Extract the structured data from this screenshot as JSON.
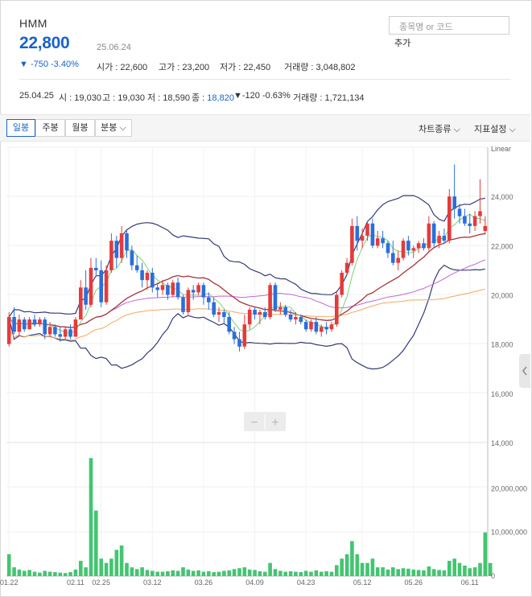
{
  "header": {
    "name": "HMM",
    "price": "22,800",
    "date": "25.06.24",
    "change": "▼ -750  -3.40%",
    "open_label": "시가 : ",
    "open": "22,600",
    "high_label": "고가 : ",
    "high": "23,200",
    "low_label": "저가 : ",
    "low": "22,450",
    "volume_label": "거래량 : ",
    "volume": "3,048,802"
  },
  "search": {
    "placeholder": "종목명 or 코드",
    "add_label": "추가"
  },
  "prev_day": {
    "date": "25.04.25",
    "open": "시 : 19,030",
    "high": "고 : 19,030",
    "low": "저 : 18,590",
    "close_label": "종 : ",
    "close": "18,820",
    "change": "▼-120  -0.63%",
    "volume": "거래량 : 1,721,134"
  },
  "toolbar": {
    "tabs": [
      "일봉",
      "주봉",
      "월봉",
      "분봉"
    ],
    "active_tab": "일봉",
    "chart_type_label": "차트종류",
    "indicator_label": "지표설정"
  },
  "zoom": {
    "minus": "−",
    "plus": "+"
  },
  "colors": {
    "up": "#e43b3b",
    "down": "#2a6fdb",
    "volume": "#43c571",
    "bollinger": "#353a7a",
    "ma_short": "#7ad27a",
    "ma_mid": "#a83236",
    "ma_long": "#c267d6",
    "ma_longest": "#f2a863"
  },
  "chart_data": {
    "type": "candlestick",
    "scale_label": "Linear",
    "ylim": [
      14000,
      26000
    ],
    "y_ticks": [
      "14,000",
      "16,000",
      "18,000",
      "20,000",
      "22,000",
      "24,000"
    ],
    "volume_ylim": [
      0,
      30000000
    ],
    "volume_ticks": [
      "0",
      "10,000,000",
      "20,000,000"
    ],
    "x_ticks": [
      "01.22",
      "02.11",
      "02.25",
      "03.12",
      "03.26",
      "04.09",
      "04.23",
      "05.12",
      "05.26",
      "06.11"
    ],
    "candles": [
      [
        18000,
        19300,
        17900,
        19100
      ],
      [
        19100,
        19500,
        18400,
        18500
      ],
      [
        18500,
        19200,
        18300,
        19000
      ],
      [
        19000,
        19100,
        18500,
        18600
      ],
      [
        18600,
        19100,
        18600,
        19000
      ],
      [
        19000,
        19200,
        18700,
        18800
      ],
      [
        18800,
        19100,
        18700,
        19000
      ],
      [
        19000,
        19100,
        18200,
        18400
      ],
      [
        18400,
        18900,
        18300,
        18700
      ],
      [
        18700,
        18800,
        18300,
        18400
      ],
      [
        18400,
        18700,
        18100,
        18300
      ],
      [
        18300,
        18700,
        18200,
        18600
      ],
      [
        18600,
        18800,
        18200,
        18300
      ],
      [
        18300,
        19100,
        18300,
        19000
      ],
      [
        19000,
        20600,
        19000,
        20300
      ],
      [
        20300,
        21000,
        19400,
        19600
      ],
      [
        19600,
        21500,
        19500,
        21100
      ],
      [
        21100,
        21500,
        20800,
        21000
      ],
      [
        21000,
        21400,
        19500,
        19700
      ],
      [
        19700,
        21200,
        19600,
        21000
      ],
      [
        21000,
        22500,
        20900,
        22200
      ],
      [
        22200,
        22400,
        21100,
        21500
      ],
      [
        21500,
        22800,
        21300,
        22500
      ],
      [
        22500,
        22600,
        21500,
        21800
      ],
      [
        21800,
        22000,
        21000,
        21200
      ],
      [
        21200,
        21600,
        20900,
        21000
      ],
      [
        21000,
        21300,
        20300,
        20600
      ],
      [
        20600,
        21000,
        20200,
        20900
      ],
      [
        20900,
        21100,
        20100,
        20300
      ],
      [
        20300,
        20500,
        19900,
        20200
      ],
      [
        20200,
        20600,
        20000,
        20400
      ],
      [
        20400,
        20500,
        19800,
        20000
      ],
      [
        20000,
        20600,
        19900,
        20500
      ],
      [
        20500,
        20700,
        19800,
        19900
      ],
      [
        19900,
        20000,
        19200,
        19300
      ],
      [
        19300,
        20300,
        19200,
        20200
      ],
      [
        20200,
        20400,
        19800,
        20100
      ],
      [
        20100,
        20500,
        20000,
        20400
      ],
      [
        20400,
        20500,
        19600,
        19900
      ],
      [
        19900,
        20100,
        19400,
        19700
      ],
      [
        19700,
        19900,
        19100,
        19200
      ],
      [
        19200,
        19500,
        18900,
        19300
      ],
      [
        19300,
        19400,
        18800,
        19100
      ],
      [
        19100,
        19300,
        18400,
        18500
      ],
      [
        18500,
        18700,
        18000,
        18200
      ],
      [
        18200,
        18500,
        17700,
        17900
      ],
      [
        17900,
        19200,
        17800,
        18800
      ],
      [
        18800,
        19500,
        18600,
        19400
      ],
      [
        19400,
        19500,
        19000,
        19200
      ],
      [
        19200,
        19400,
        18800,
        19300
      ],
      [
        19300,
        19500,
        19000,
        19100
      ],
      [
        19100,
        20500,
        19000,
        20400
      ],
      [
        20400,
        20500,
        19300,
        19400
      ],
      [
        19400,
        19700,
        19200,
        19500
      ],
      [
        19500,
        19600,
        19100,
        19200
      ],
      [
        19200,
        19400,
        18900,
        19000
      ],
      [
        19000,
        19300,
        18800,
        19100
      ],
      [
        19100,
        19200,
        18800,
        18900
      ],
      [
        18900,
        19000,
        18500,
        18600
      ],
      [
        18600,
        19000,
        18500,
        18900
      ],
      [
        18900,
        19100,
        18400,
        18500
      ],
      [
        18500,
        18800,
        18300,
        18700
      ],
      [
        18700,
        18900,
        18400,
        18600
      ],
      [
        18600,
        18900,
        18500,
        18800
      ],
      [
        18800,
        20100,
        18700,
        20000
      ],
      [
        20000,
        21000,
        19900,
        20900
      ],
      [
        20900,
        21500,
        20800,
        21300
      ],
      [
        21300,
        23100,
        21200,
        22800
      ],
      [
        22800,
        23200,
        21800,
        22200
      ],
      [
        22200,
        22700,
        21900,
        22400
      ],
      [
        22400,
        23000,
        22200,
        22900
      ],
      [
        22900,
        23100,
        21900,
        22000
      ],
      [
        22000,
        22600,
        21900,
        22300
      ],
      [
        22300,
        22600,
        21900,
        22100
      ],
      [
        22100,
        22200,
        21500,
        21700
      ],
      [
        21700,
        22200,
        21200,
        21300
      ],
      [
        21300,
        21800,
        21000,
        21500
      ],
      [
        21500,
        22300,
        21400,
        22200
      ],
      [
        22200,
        22400,
        21600,
        21800
      ],
      [
        21800,
        22000,
        21500,
        21900
      ],
      [
        21900,
        22200,
        21700,
        22100
      ],
      [
        22100,
        22300,
        21800,
        21900
      ],
      [
        21900,
        23200,
        21800,
        22900
      ],
      [
        22900,
        23000,
        21900,
        22100
      ],
      [
        22100,
        22600,
        21900,
        22400
      ],
      [
        22400,
        22700,
        22100,
        22200
      ],
      [
        22200,
        24300,
        22100,
        24000
      ],
      [
        24000,
        25300,
        23100,
        23500
      ],
      [
        23500,
        23700,
        22900,
        23200
      ],
      [
        23200,
        23500,
        22800,
        22900
      ],
      [
        22900,
        23300,
        22500,
        22800
      ],
      [
        22800,
        23400,
        22600,
        23200
      ],
      [
        23200,
        24700,
        22900,
        23400
      ],
      [
        22600,
        23200,
        22450,
        22800
      ]
    ],
    "volume_millions": [
      5,
      2,
      1.5,
      1.2,
      1.4,
      1.0,
      0.8,
      1.2,
      1.0,
      0.9,
      0.8,
      0.7,
      0.9,
      1.5,
      3.5,
      2.0,
      27,
      15,
      4,
      3,
      4,
      6,
      7,
      3,
      2,
      1.6,
      2.0,
      1.4,
      1.2,
      1.0,
      1.0,
      1.1,
      1.3,
      1.2,
      2.0,
      1.5,
      1.2,
      1.3,
      1.0,
      1.1,
      0.9,
      1.0,
      1.2,
      1.3,
      1.6,
      1.8,
      2.0,
      1.5,
      1.4,
      1.1,
      1.0,
      3.0,
      1.6,
      1.2,
      1.0,
      1.1,
      1.0,
      0.9,
      1.2,
      1.0,
      1.3,
      1.0,
      1.1,
      1.0,
      2.5,
      4,
      5,
      8,
      5,
      3,
      3,
      4,
      2,
      2,
      1.5,
      2,
      1.6,
      1.8,
      1.7,
      1.5,
      1.4,
      1.3,
      2.2,
      1.6,
      1.4,
      1.3,
      3.5,
      4,
      3.0,
      2.4,
      1.8,
      2.0,
      3.0,
      10,
      3.0
    ]
  }
}
